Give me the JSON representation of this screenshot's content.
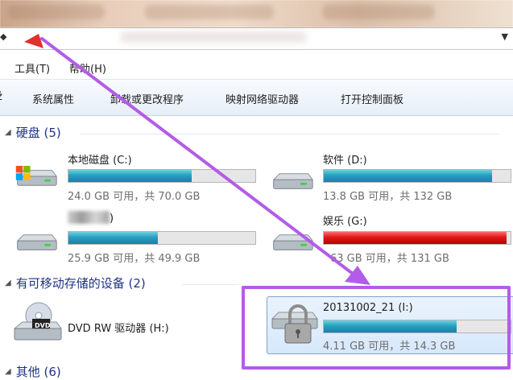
{
  "menu": {
    "tools": "工具(T)",
    "help": "帮助(H)"
  },
  "toolbar": {
    "left_fragment": "ž",
    "system_properties": "系统属性",
    "uninstall": "卸载或更改程序",
    "map_drive": "映射网络驱动器",
    "control_panel": "打开控制面板"
  },
  "groups": {
    "hard_disks": "硬盘 (5)",
    "removable": "有可移动存储的设备 (2)",
    "other": "其他 (6)"
  },
  "drives": {
    "c": {
      "name": "本地磁盘 (C:)",
      "cap": "24.0 GB 可用，共 70.0 GB",
      "used_fraction": 0.66
    },
    "d": {
      "name": "软件 (D:)",
      "cap": "13.8 GB 可用，共 132 GB",
      "used_fraction": 0.9
    },
    "e": {
      "name": ")",
      "cap": "25.9 GB 可用，共 49.9 GB",
      "used_fraction": 0.48
    },
    "g": {
      "name": "娱乐 (G:)",
      "cap": "63 GB 可用，共 131 GB",
      "used_fraction": 0.98
    },
    "h": {
      "name": "DVD RW 驱动器 (H:)"
    },
    "i": {
      "name": "20131002_21 (I:)",
      "cap": "4.11 GB 可用，共 14.3 GB",
      "used_fraction": 0.71
    }
  },
  "icons": {
    "dvd_label": "DVD",
    "hdd": "hard-disk-icon",
    "windows_drive": "windows-drive-icon",
    "lock_drive": "locked-usb-drive-icon",
    "dvd": "dvd-drive-icon",
    "arrow": "pointer-arrow"
  },
  "colors": {
    "bar_fill": "#26a0c0",
    "bar_full": "#e01818",
    "highlight": "#b35ce8",
    "group_header": "#1e3287"
  }
}
